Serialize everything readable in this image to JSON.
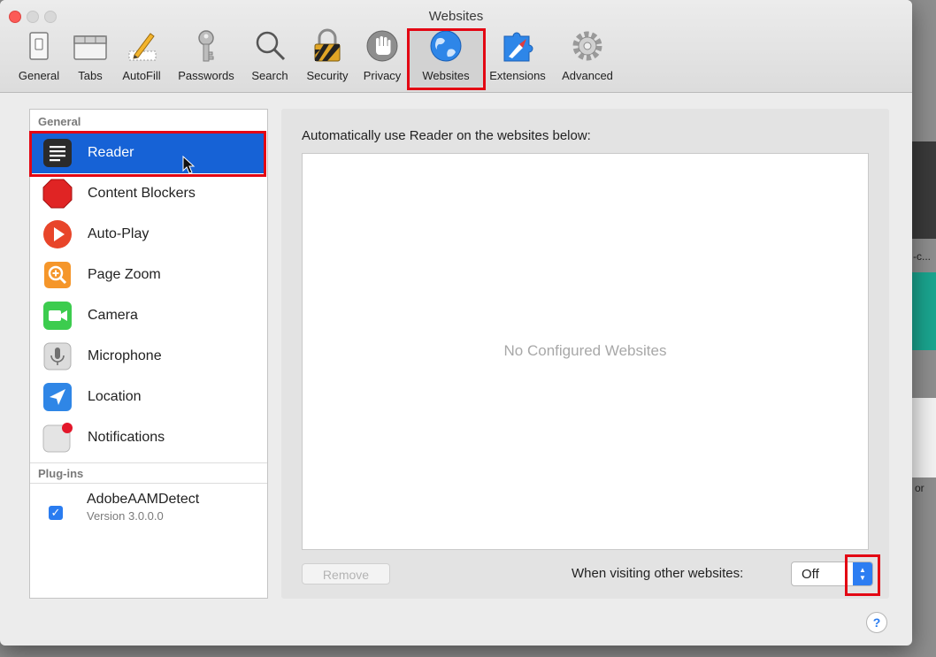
{
  "window": {
    "title": "Websites"
  },
  "toolbar": {
    "items": [
      {
        "label": "General",
        "icon": "general-switch-icon"
      },
      {
        "label": "Tabs",
        "icon": "tabs-icon"
      },
      {
        "label": "AutoFill",
        "icon": "autofill-pencil-icon"
      },
      {
        "label": "Passwords",
        "icon": "key-icon"
      },
      {
        "label": "Search",
        "icon": "magnifier-icon"
      },
      {
        "label": "Security",
        "icon": "lock-icon"
      },
      {
        "label": "Privacy",
        "icon": "hand-icon"
      },
      {
        "label": "Websites",
        "icon": "globe-icon",
        "selected": true
      },
      {
        "label": "Extensions",
        "icon": "compass-puzzle-icon"
      },
      {
        "label": "Advanced",
        "icon": "gear-icon"
      }
    ]
  },
  "sidebar": {
    "general_header": "General",
    "items": [
      {
        "label": "Reader",
        "icon": "reader-icon",
        "selected": true
      },
      {
        "label": "Content Blockers",
        "icon": "stop-sign-icon"
      },
      {
        "label": "Auto-Play",
        "icon": "play-icon"
      },
      {
        "label": "Page Zoom",
        "icon": "zoom-icon"
      },
      {
        "label": "Camera",
        "icon": "camera-icon"
      },
      {
        "label": "Microphone",
        "icon": "microphone-icon"
      },
      {
        "label": "Location",
        "icon": "location-arrow-icon"
      },
      {
        "label": "Notifications",
        "icon": "notifications-icon"
      }
    ],
    "plugins_header": "Plug-ins",
    "plugins": [
      {
        "name": "AdobeAAMDetect",
        "version": "Version 3.0.0.0",
        "checked": true
      }
    ]
  },
  "main": {
    "heading": "Automatically use Reader on the websites below:",
    "empty_text": "No Configured Websites",
    "remove_label": "Remove",
    "other_websites_label": "When visiting other websites:",
    "other_websites_value": "Off",
    "help_label": "?"
  },
  "background": {
    "fragment_a": "-c...",
    "fragment_b": "or"
  },
  "colors": {
    "selection": "#1662d6",
    "highlight": "#e30613",
    "accent": "#2c7df2"
  }
}
